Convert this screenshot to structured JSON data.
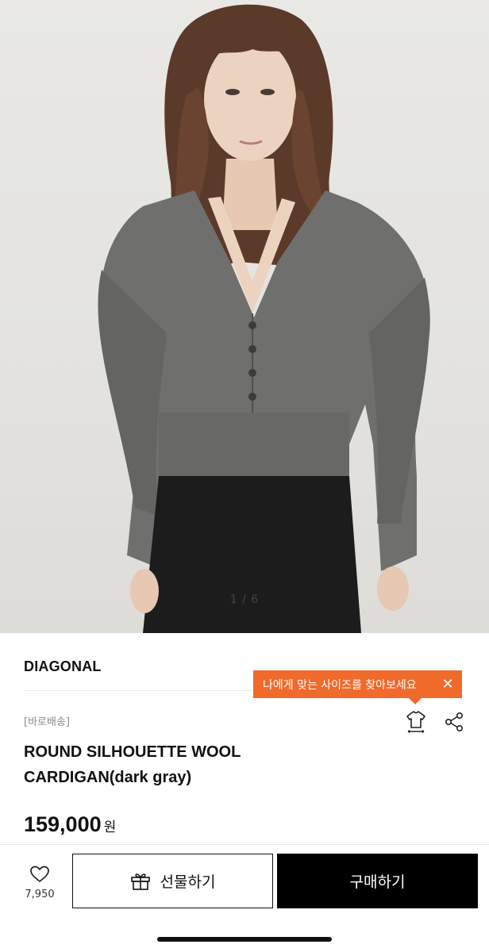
{
  "gallery": {
    "image": "model-wearing-gray-wool-cardigan",
    "counter": "1 / 6"
  },
  "product": {
    "brand": "DIAGONAL",
    "delivery_tag": "[바로배송]",
    "title_line1": "ROUND SILHOUETTE WOOL",
    "title_line2": "CARDIGAN(dark gray)",
    "price": "159,000",
    "price_unit": "원"
  },
  "size_tooltip": {
    "text": "나에게 맞는 사이즈를 찾아보세요",
    "close_label": "✕",
    "color": "#f06a2b"
  },
  "icons": {
    "size": "size-guide-shirt-icon",
    "share": "share-icon",
    "like": "heart-icon",
    "gift": "gift-icon"
  },
  "bottom_bar": {
    "like_count": "7,950",
    "gift_label": "선물하기",
    "buy_label": "구매하기"
  }
}
